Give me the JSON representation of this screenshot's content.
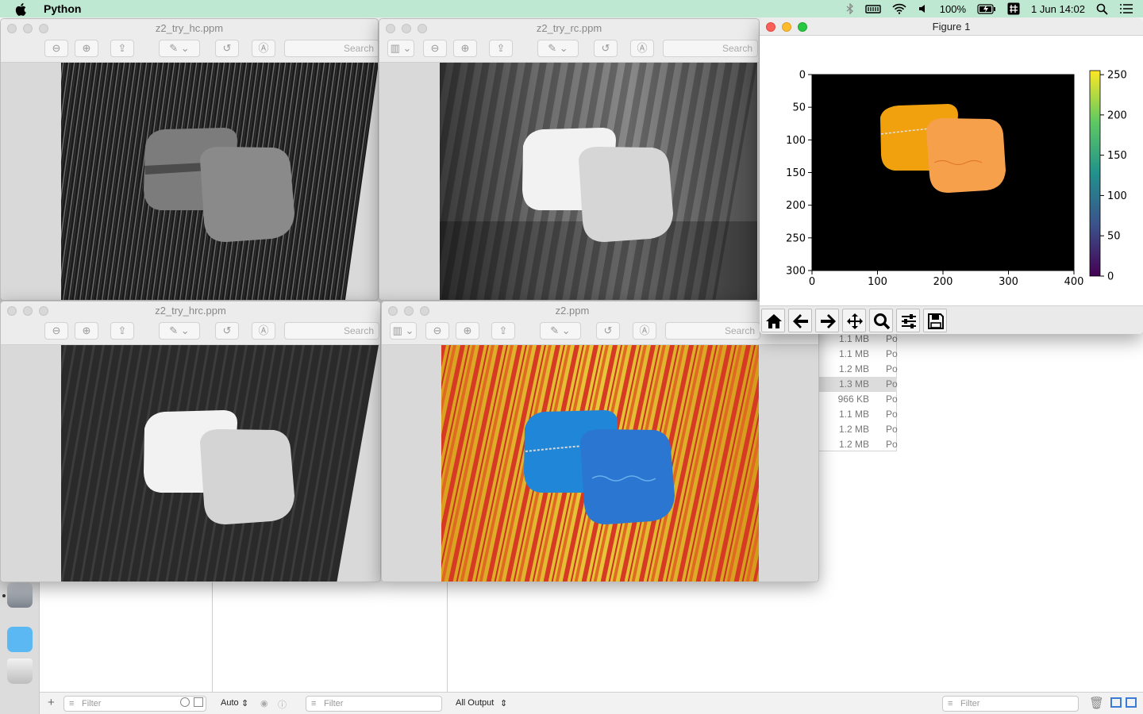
{
  "menubar": {
    "app_name": "Python",
    "battery": "100%",
    "date_time": "1 Jun  14:02"
  },
  "windows": {
    "hc": {
      "title": "z2_try_hc.ppm",
      "search": "Search"
    },
    "rc": {
      "title": "z2_try_rc.ppm",
      "search": "Search"
    },
    "hrc": {
      "title": "z2_try_hrc.ppm",
      "search": "Search"
    },
    "orig": {
      "title": "z2.ppm",
      "search": "Search"
    }
  },
  "figure": {
    "title": "Figure 1",
    "yticks": [
      "0",
      "50",
      "100",
      "150",
      "200",
      "250",
      "300"
    ],
    "xticks": [
      "0",
      "100",
      "200",
      "300",
      "400"
    ],
    "colorbar_ticks": [
      "250",
      "200",
      "150",
      "100",
      "50",
      "0"
    ]
  },
  "files": [
    {
      "size": "1.1 MB",
      "kind": "Po"
    },
    {
      "size": "1.1 MB",
      "kind": "Po"
    },
    {
      "size": "1.2 MB",
      "kind": "Po"
    },
    {
      "size": "1.3 MB",
      "kind": "Po"
    },
    {
      "size": "966 KB",
      "kind": "Po"
    },
    {
      "size": "1.1 MB",
      "kind": "Po"
    },
    {
      "size": "1.2 MB",
      "kind": "Po"
    },
    {
      "size": "1.2 MB",
      "kind": "Po"
    }
  ],
  "bottom": {
    "filter1": "Filter",
    "auto": "Auto",
    "filter2": "Filter",
    "all_output": "All Output",
    "filter3": "Filter"
  }
}
